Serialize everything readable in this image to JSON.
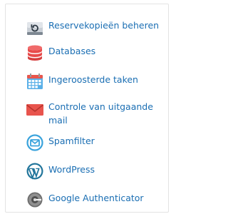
{
  "menu": {
    "items": [
      {
        "label": "Reservekopieën beheren",
        "icon": "backup-restore-icon"
      },
      {
        "label": "Databases",
        "icon": "database-icon"
      },
      {
        "label": "Ingeroosterde taken",
        "icon": "calendar-icon"
      },
      {
        "label": "Controle van uitgaande mail",
        "icon": "mail-icon"
      },
      {
        "label": "Spamfilter",
        "icon": "spamfilter-icon"
      },
      {
        "label": "WordPress",
        "icon": "wordpress-icon"
      },
      {
        "label": "Google Authenticator",
        "icon": "google-authenticator-icon"
      }
    ]
  },
  "colors": {
    "link": "#1a6eb3",
    "panel_border": "#e3e3e3",
    "database_red": "#e84b4b",
    "calendar_blue": "#5ab0e8",
    "mail_red": "#e8544d",
    "spam_blue": "#3aa3dc",
    "wordpress_blue": "#21759b",
    "authenticator_gray": "#6d6d6d"
  }
}
